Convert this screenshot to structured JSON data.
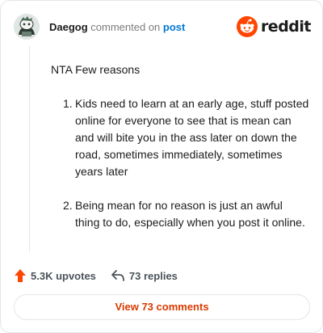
{
  "header": {
    "username": "Daegog",
    "action_text": "commented on",
    "post_link": "post",
    "brand_name": "reddit",
    "avatar_icon": "snoo-avatar-icon",
    "brand_icon": "reddit-logo-icon"
  },
  "comment": {
    "intro": "NTA Few reasons",
    "reasons": [
      {
        "number": "1.",
        "text": "Kids need to learn at an early age, stuff posted online for everyone to see that is mean can and will bite you in the ass later on down the road, sometimes immediately, sometimes years later"
      },
      {
        "number": "2.",
        "text": "Being mean for no reason is just an awful thing to do, especially when you post it online."
      }
    ]
  },
  "footer": {
    "upvotes_label": "5.3K upvotes",
    "replies_label": "73 replies",
    "view_comments_label": "View 73 comments",
    "upvote_icon": "upvote-arrow-icon",
    "reply_icon": "reply-arrow-icon"
  },
  "colors": {
    "accent": "#ff4500",
    "link": "#0079d3",
    "view_button_text": "#d93a00",
    "border": "#e3e6e8"
  }
}
